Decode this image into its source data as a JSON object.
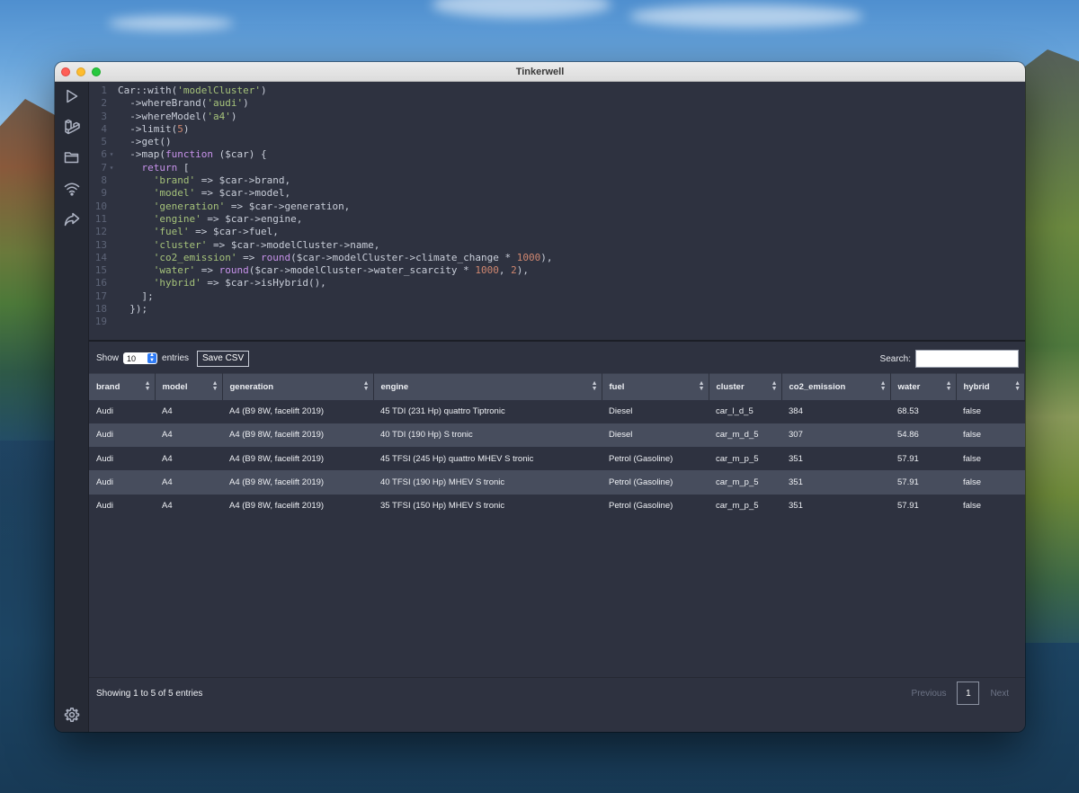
{
  "window": {
    "title": "Tinkerwell"
  },
  "sidebar": {
    "items": [
      {
        "icon": "play-icon"
      },
      {
        "icon": "laravel-icon"
      },
      {
        "icon": "folder-icon"
      },
      {
        "icon": "wifi-icon"
      },
      {
        "icon": "share-icon"
      }
    ],
    "settings_icon": "gear-icon"
  },
  "editor": {
    "lines": [
      {
        "n": "1",
        "fold": "",
        "tokens": [
          [
            "p",
            "Car::with("
          ],
          [
            "s",
            "'modelCluster'"
          ],
          [
            "p",
            ")"
          ]
        ]
      },
      {
        "n": "2",
        "fold": "",
        "tokens": [
          [
            "p",
            "  ->whereBrand("
          ],
          [
            "s",
            "'audi'"
          ],
          [
            "p",
            ")"
          ]
        ]
      },
      {
        "n": "3",
        "fold": "",
        "tokens": [
          [
            "p",
            "  ->whereModel("
          ],
          [
            "s",
            "'a4'"
          ],
          [
            "p",
            ")"
          ]
        ]
      },
      {
        "n": "4",
        "fold": "",
        "tokens": [
          [
            "p",
            "  ->limit("
          ],
          [
            "n",
            "5"
          ],
          [
            "p",
            ")"
          ]
        ]
      },
      {
        "n": "5",
        "fold": "",
        "tokens": [
          [
            "p",
            "  ->get()"
          ]
        ]
      },
      {
        "n": "6",
        "fold": "▾",
        "tokens": [
          [
            "p",
            "  ->map("
          ],
          [
            "k",
            "function"
          ],
          [
            "p",
            " ($car) {"
          ]
        ]
      },
      {
        "n": "7",
        "fold": "▾",
        "tokens": [
          [
            "p",
            "    "
          ],
          [
            "k",
            "return"
          ],
          [
            "p",
            " ["
          ]
        ]
      },
      {
        "n": "8",
        "fold": "",
        "tokens": [
          [
            "p",
            "      "
          ],
          [
            "s",
            "'brand'"
          ],
          [
            "p",
            " => $car->brand,"
          ]
        ]
      },
      {
        "n": "9",
        "fold": "",
        "tokens": [
          [
            "p",
            "      "
          ],
          [
            "s",
            "'model'"
          ],
          [
            "p",
            " => $car->model,"
          ]
        ]
      },
      {
        "n": "10",
        "fold": "",
        "tokens": [
          [
            "p",
            "      "
          ],
          [
            "s",
            "'generation'"
          ],
          [
            "p",
            " => $car->generation,"
          ]
        ]
      },
      {
        "n": "11",
        "fold": "",
        "tokens": [
          [
            "p",
            "      "
          ],
          [
            "s",
            "'engine'"
          ],
          [
            "p",
            " => $car->engine,"
          ]
        ]
      },
      {
        "n": "12",
        "fold": "",
        "tokens": [
          [
            "p",
            "      "
          ],
          [
            "s",
            "'fuel'"
          ],
          [
            "p",
            " => $car->fuel,"
          ]
        ]
      },
      {
        "n": "13",
        "fold": "",
        "tokens": [
          [
            "p",
            "      "
          ],
          [
            "s",
            "'cluster'"
          ],
          [
            "p",
            " => $car->modelCluster->name,"
          ]
        ]
      },
      {
        "n": "14",
        "fold": "",
        "tokens": [
          [
            "p",
            "      "
          ],
          [
            "s",
            "'co2_emission'"
          ],
          [
            "p",
            " => "
          ],
          [
            "k",
            "round"
          ],
          [
            "p",
            "($car->modelCluster->climate_change * "
          ],
          [
            "n",
            "1000"
          ],
          [
            "p",
            "),"
          ]
        ]
      },
      {
        "n": "15",
        "fold": "",
        "tokens": [
          [
            "p",
            "      "
          ],
          [
            "s",
            "'water'"
          ],
          [
            "p",
            " => "
          ],
          [
            "k",
            "round"
          ],
          [
            "p",
            "($car->modelCluster->water_scarcity * "
          ],
          [
            "n",
            "1000"
          ],
          [
            "p",
            ", "
          ],
          [
            "n",
            "2"
          ],
          [
            "p",
            "),"
          ]
        ]
      },
      {
        "n": "16",
        "fold": "",
        "tokens": [
          [
            "p",
            "      "
          ],
          [
            "s",
            "'hybrid'"
          ],
          [
            "p",
            " => $car->isHybrid(),"
          ]
        ]
      },
      {
        "n": "17",
        "fold": "",
        "tokens": [
          [
            "p",
            "    ];"
          ]
        ]
      },
      {
        "n": "18",
        "fold": "",
        "tokens": [
          [
            "p",
            "  });"
          ]
        ]
      },
      {
        "n": "19",
        "fold": "",
        "tokens": []
      }
    ]
  },
  "results": {
    "show_label": "Show",
    "entries_value": "10",
    "entries_label": "entries",
    "save_csv_label": "Save CSV",
    "search_label": "Search:",
    "search_value": "",
    "columns": [
      "brand",
      "model",
      "generation",
      "engine",
      "fuel",
      "cluster",
      "co2_emission",
      "water",
      "hybrid"
    ],
    "rows": [
      [
        "Audi",
        "A4",
        "A4 (B9 8W, facelift 2019)",
        "45 TDI (231 Hp) quattro Tiptronic",
        "Diesel",
        "car_l_d_5",
        "384",
        "68.53",
        "false"
      ],
      [
        "Audi",
        "A4",
        "A4 (B9 8W, facelift 2019)",
        "40 TDI (190 Hp) S tronic",
        "Diesel",
        "car_m_d_5",
        "307",
        "54.86",
        "false"
      ],
      [
        "Audi",
        "A4",
        "A4 (B9 8W, facelift 2019)",
        "45 TFSI (245 Hp) quattro MHEV S tronic",
        "Petrol (Gasoline)",
        "car_m_p_5",
        "351",
        "57.91",
        "false"
      ],
      [
        "Audi",
        "A4",
        "A4 (B9 8W, facelift 2019)",
        "40 TFSI (190 Hp) MHEV S tronic",
        "Petrol (Gasoline)",
        "car_m_p_5",
        "351",
        "57.91",
        "false"
      ],
      [
        "Audi",
        "A4",
        "A4 (B9 8W, facelift 2019)",
        "35 TFSI (150 Hp) MHEV S tronic",
        "Petrol (Gasoline)",
        "car_m_p_5",
        "351",
        "57.91",
        "false"
      ]
    ],
    "info": "Showing 1 to 5 of 5 entries",
    "pager": {
      "previous": "Previous",
      "page": "1",
      "next": "Next"
    }
  }
}
